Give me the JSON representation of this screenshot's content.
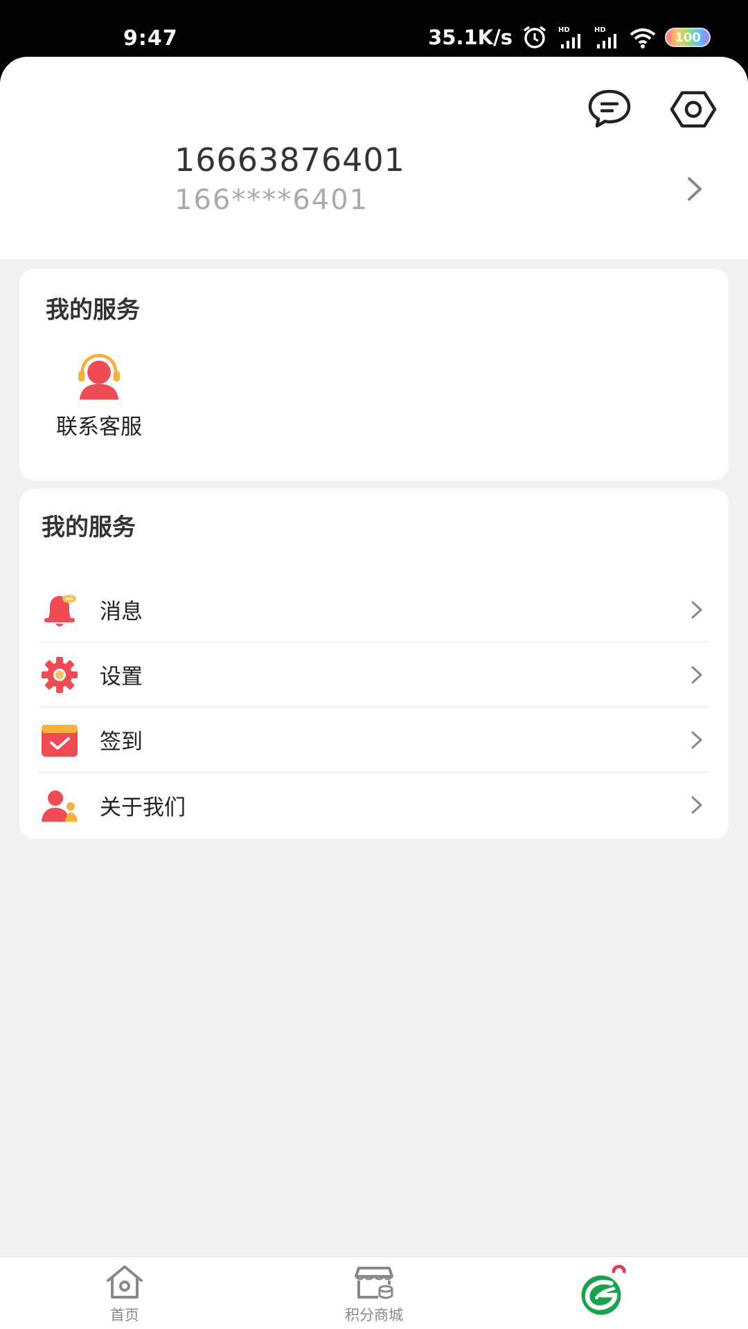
{
  "status_bar": {
    "time": "9:47",
    "net_speed": "35.1K/s",
    "battery": "100",
    "icons": [
      "alarm-icon",
      "hd-signal-icon",
      "hd-signal-icon",
      "wifi-icon",
      "battery-icon"
    ]
  },
  "header": {
    "icons": [
      "message-icon",
      "settings-icon"
    ],
    "name": "16663876401",
    "phone_masked": "166****6401"
  },
  "services_card": {
    "title": "我的服务",
    "items": [
      {
        "label": "联系客服",
        "icon": "customer-service-icon"
      }
    ]
  },
  "menu_card": {
    "title": "我的服务",
    "items": [
      {
        "label": "消息",
        "icon": "bell-icon"
      },
      {
        "label": "设置",
        "icon": "gear-icon"
      },
      {
        "label": "签到",
        "icon": "checkin-icon"
      },
      {
        "label": "关于我们",
        "icon": "about-us-icon"
      }
    ]
  },
  "bottom_nav": {
    "items": [
      {
        "label": "首页",
        "icon": "home-icon"
      },
      {
        "label": "积分商城",
        "icon": "store-icon"
      },
      {
        "label": "",
        "icon": "leaf-logo-icon",
        "active": true
      }
    ]
  },
  "colors": {
    "accent_red": "#f04a52",
    "brand_green": "#16a34a",
    "background": "#f1f1f1"
  }
}
